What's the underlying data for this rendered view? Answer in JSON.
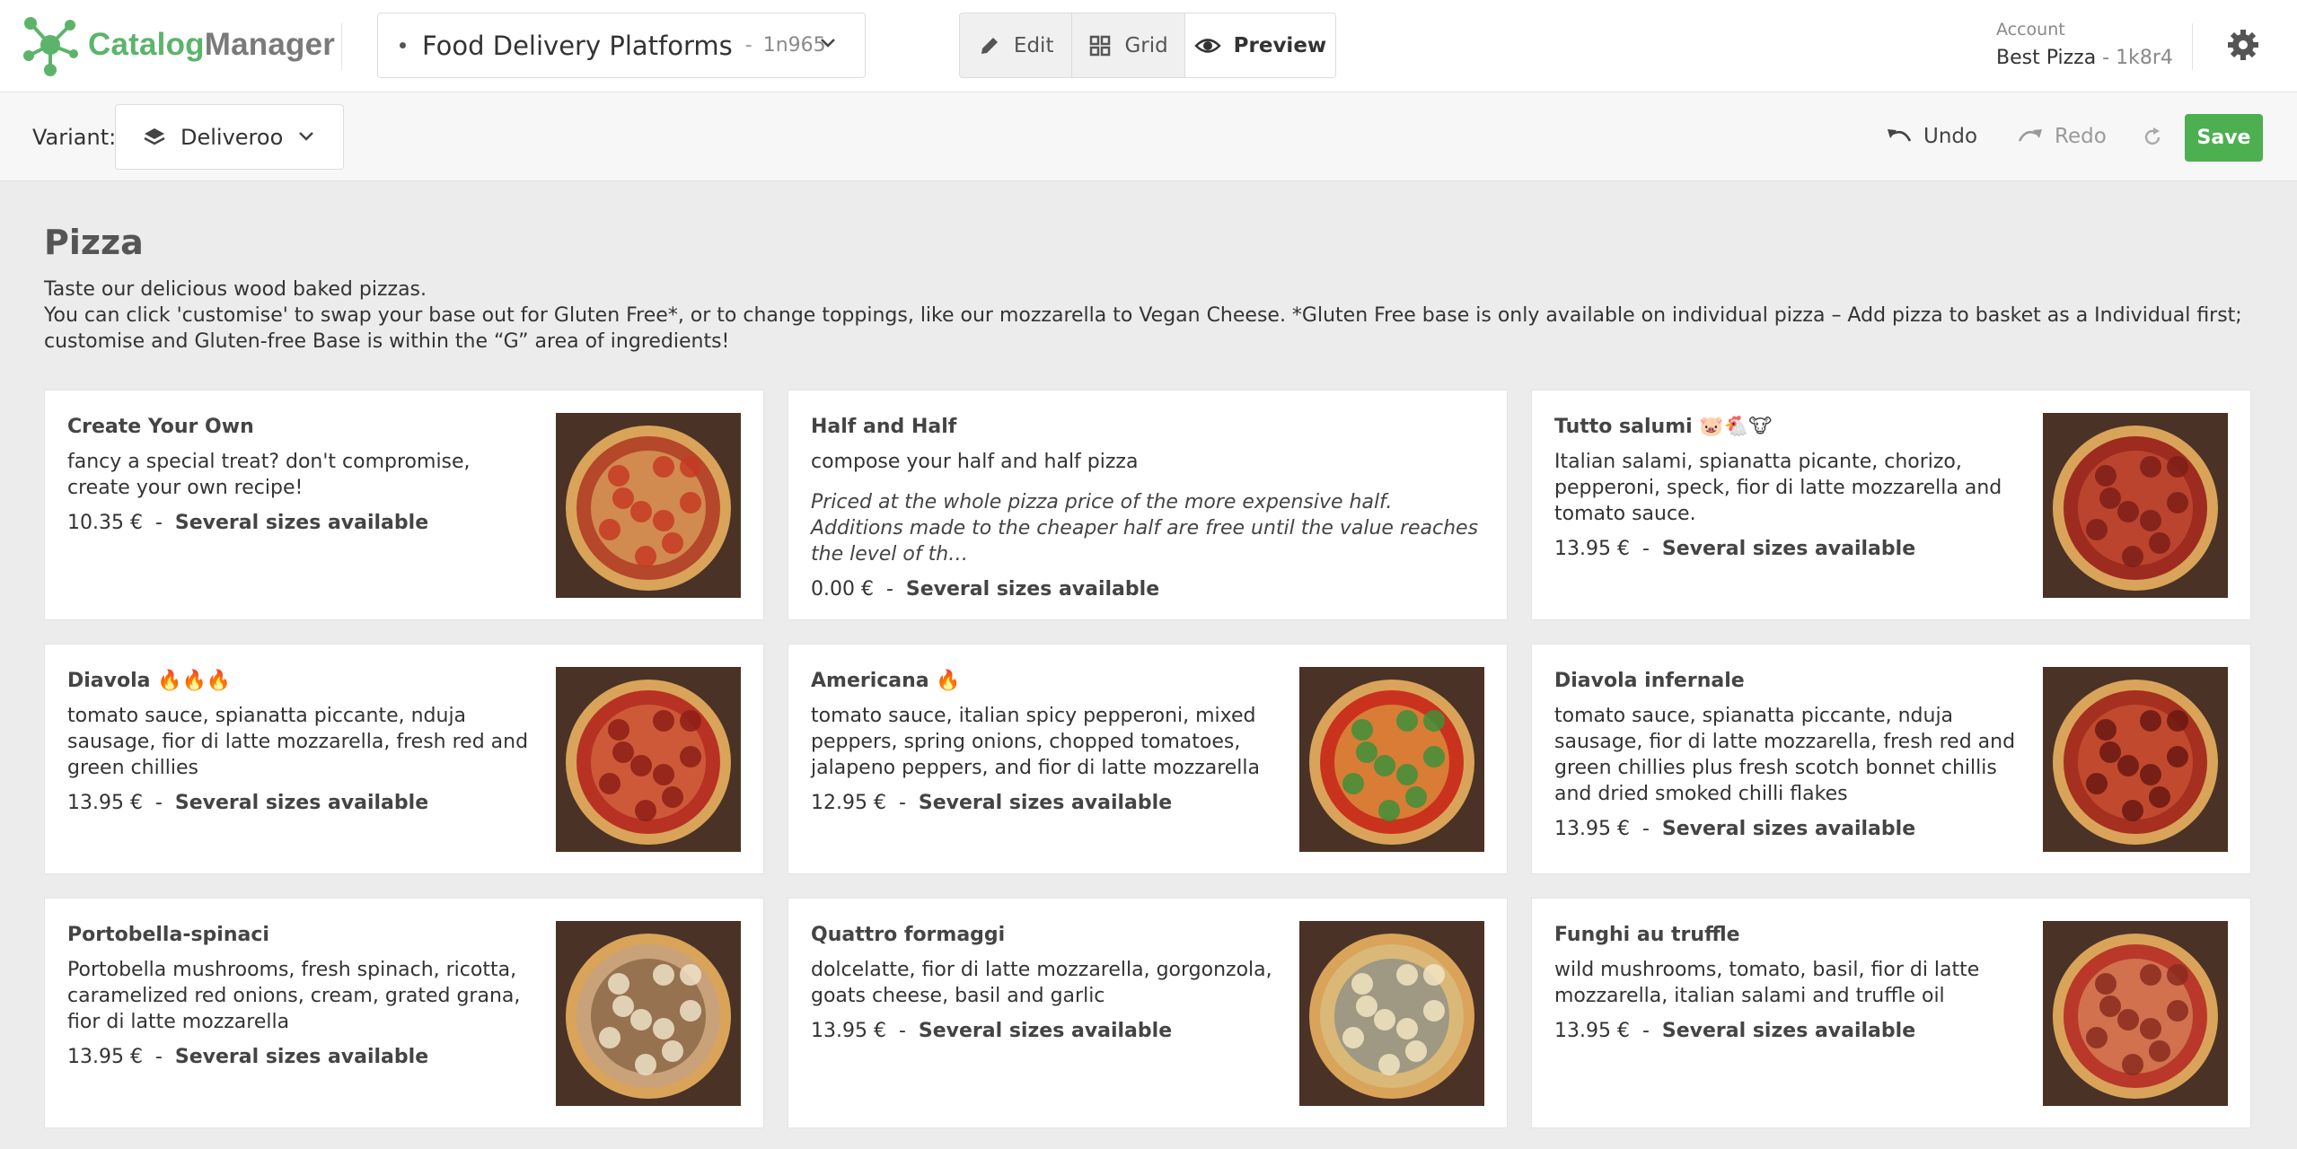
{
  "app": {
    "name_a": "Catalog",
    "name_b": "Manager"
  },
  "catalog": {
    "name": "Food Delivery Platforms",
    "code": "1n965"
  },
  "modes": [
    {
      "label": "Edit",
      "icon": "pencil-icon"
    },
    {
      "label": "Grid",
      "icon": "grid-icon"
    },
    {
      "label": "Preview",
      "icon": "eye-icon"
    }
  ],
  "account": {
    "label": "Account",
    "name": "Best Pizza",
    "code": "1k8r4"
  },
  "toolbar": {
    "variant_label": "Variant:",
    "variant_value": "Deliveroo",
    "undo": "Undo",
    "redo": "Redo",
    "save": "Save"
  },
  "category": {
    "title": "Pizza",
    "desc_line1": "Taste our delicious wood baked pizzas.",
    "desc_line2": "You can click 'customise' to swap your base out for Gluten Free*, or to change toppings, like our mozzarella to Vegan Cheese. *Gluten Free base is only available on individual pizza – Add pizza to basket as a Individual first; customise and Gluten-free Base is within the “G” area of ingredients!"
  },
  "colors": {
    "accent": "#4caf50",
    "logo": "#5bb46a"
  },
  "products": [
    {
      "name": "Create Your Own",
      "desc": "fancy a special treat? don't compromise, create your own recipe!",
      "price": "10.35 €",
      "sizes": "Several sizes available"
    },
    {
      "name": "Half and Half",
      "desc": "compose your half and half pizza",
      "note": "Priced at the whole pizza price of the more expensive half. Additions made to the cheaper half are free until the value reaches the level of th…",
      "price": "0.00 €",
      "sizes": "Several sizes available"
    },
    {
      "name": "Tutto salumi 🐷🐔🐮",
      "desc": "Italian salami, spianatta picante, chorizo, pepperoni, speck, fior di latte mozzarella and tomato sauce.",
      "price": "13.95 €",
      "sizes": "Several sizes available"
    },
    {
      "name": "Diavola 🔥🔥🔥",
      "desc": "tomato sauce, spianatta piccante, nduja sausage, fior di latte mozzarella, fresh red and green chillies",
      "price": "13.95 €",
      "sizes": "Several sizes available"
    },
    {
      "name": "Americana 🔥",
      "desc": "tomato sauce, italian spicy pepperoni, mixed peppers, spring onions, chopped tomatoes, jalapeno peppers, and fior di latte mozzarella",
      "price": "12.95 €",
      "sizes": "Several sizes available"
    },
    {
      "name": "Diavola infernale",
      "desc": "tomato sauce, spianatta piccante, nduja sausage, fior di latte mozzarella, fresh red and green chillies plus fresh scotch bonnet chillis and dried smoked chilli flakes",
      "price": "13.95 €",
      "sizes": "Several sizes available"
    },
    {
      "name": "Portobella-spinaci",
      "desc": "Portobella mushrooms, fresh spinach, ricotta, caramelized red onions, cream, grated grana, fior di latte mozzarella",
      "price": "13.95 €",
      "sizes": "Several sizes available"
    },
    {
      "name": "Quattro formaggi",
      "desc": "dolcelatte, fior di latte mozzarella, gorgonzola, goats cheese, basil and garlic",
      "price": "13.95 €",
      "sizes": "Several sizes available"
    },
    {
      "name": "Funghi au truffle",
      "desc": "wild mushrooms, tomato, basil, fior di latte mozzarella, italian salami and truffle oil",
      "price": "13.95 €",
      "sizes": "Several sizes available"
    }
  ]
}
